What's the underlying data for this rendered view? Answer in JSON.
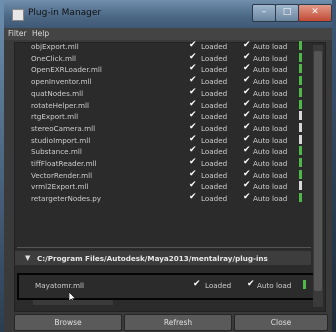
{
  "window": {
    "title": "Plug-in Manager",
    "min_glyph": "–",
    "max_glyph": "□",
    "close_glyph": "✕"
  },
  "menu": {
    "filter": "Filter",
    "help": "Help"
  },
  "plugins": [
    {
      "name": "objExport.mll",
      "loaded": true,
      "auto_load": true,
      "info": "green"
    },
    {
      "name": "OneClick.mll",
      "loaded": true,
      "auto_load": true,
      "info": "green"
    },
    {
      "name": "OpenEXRLoader.mll",
      "loaded": true,
      "auto_load": true,
      "info": "green"
    },
    {
      "name": "openInventor.mll",
      "loaded": true,
      "auto_load": true,
      "info": "green"
    },
    {
      "name": "quatNodes.mll",
      "loaded": true,
      "auto_load": true,
      "info": "green"
    },
    {
      "name": "rotateHelper.mll",
      "loaded": true,
      "auto_load": true,
      "info": "green"
    },
    {
      "name": "rtgExport.mll",
      "loaded": true,
      "auto_load": true,
      "info": "white"
    },
    {
      "name": "stereoCamera.mll",
      "loaded": true,
      "auto_load": true,
      "info": "white"
    },
    {
      "name": "studioImport.mll",
      "loaded": true,
      "auto_load": true,
      "info": "white"
    },
    {
      "name": "Substance.mll",
      "loaded": true,
      "auto_load": true,
      "info": "green"
    },
    {
      "name": "tiffFloatReader.mll",
      "loaded": true,
      "auto_load": true,
      "info": "green"
    },
    {
      "name": "VectorRender.mll",
      "loaded": true,
      "auto_load": true,
      "info": "green"
    },
    {
      "name": "vrml2Export.mll",
      "loaded": true,
      "auto_load": true,
      "info": "white"
    },
    {
      "name": "retargeterNodes.py",
      "loaded": true,
      "auto_load": true,
      "info": "green"
    }
  ],
  "labels": {
    "loaded": "Loaded",
    "auto_load": "Auto load",
    "check": "✔"
  },
  "section": {
    "path": "C:/Program Files/Autodesk/Maya2013/mentalray/plug-ins",
    "expand_glyph": "▼"
  },
  "highlighted_plugin": {
    "name": "Mayatomr.mll",
    "loaded": true,
    "auto_load": true,
    "info": "green"
  },
  "buttons": {
    "browse": "Browse",
    "refresh": "Refresh",
    "close": "Close"
  }
}
